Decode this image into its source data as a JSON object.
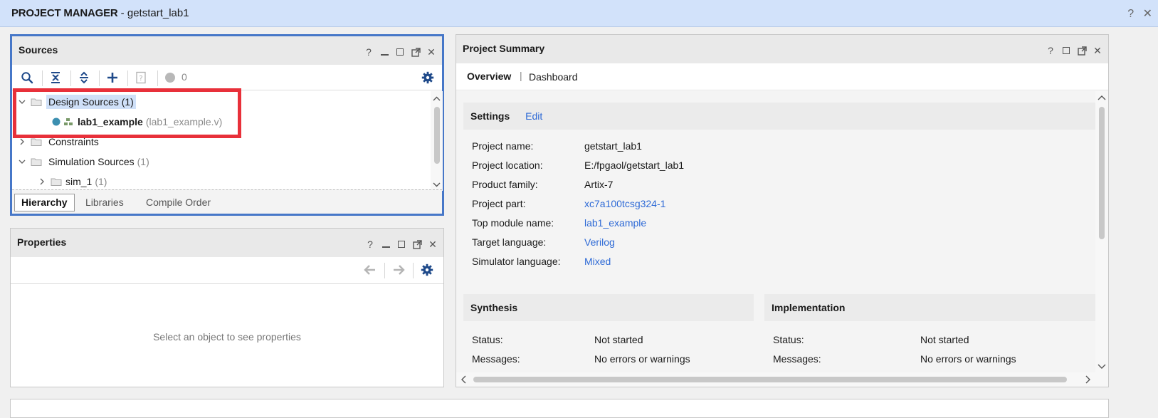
{
  "window": {
    "section_name": "PROJECT MANAGER",
    "separator": " - ",
    "project": "getstart_lab1",
    "help_glyph": "?",
    "close_glyph": "✕"
  },
  "sources": {
    "title": "Sources",
    "badge_count": "0",
    "tree": [
      {
        "label": "Design Sources",
        "count": "(1)"
      },
      {
        "label": "lab1_example",
        "file": "(lab1_example.v)"
      },
      {
        "label": "Constraints"
      },
      {
        "label": "Simulation Sources",
        "count": "(1)"
      },
      {
        "label": "sim_1",
        "count": "(1)"
      }
    ],
    "tabs": [
      "Hierarchy",
      "Libraries",
      "Compile Order"
    ],
    "active_tab": "Hierarchy"
  },
  "properties": {
    "title": "Properties",
    "empty_message": "Select an object to see properties"
  },
  "summary": {
    "title": "Project Summary",
    "tabs": [
      "Overview",
      "Dashboard"
    ],
    "tab_separator": "|",
    "settings": {
      "title": "Settings",
      "edit_link": "Edit",
      "rows": [
        {
          "label": "Project name:",
          "value": "getstart_lab1",
          "link": false
        },
        {
          "label": "Project location:",
          "value": "E:/fpgaol/getstart_lab1",
          "link": false
        },
        {
          "label": "Product family:",
          "value": "Artix-7",
          "link": false
        },
        {
          "label": "Project part:",
          "value": "xc7a100tcsg324-1",
          "link": true
        },
        {
          "label": "Top module name:",
          "value": "lab1_example",
          "link": true
        },
        {
          "label": "Target language:",
          "value": "Verilog",
          "link": true
        },
        {
          "label": "Simulator language:",
          "value": "Mixed",
          "link": true
        }
      ]
    },
    "synthesis": {
      "title": "Synthesis",
      "rows": [
        {
          "label": "Status:",
          "value": "Not started"
        },
        {
          "label": "Messages:",
          "value": "No errors or warnings"
        }
      ]
    },
    "implementation": {
      "title": "Implementation",
      "rows": [
        {
          "label": "Status:",
          "value": "Not started"
        },
        {
          "label": "Messages:",
          "value": "No errors or warnings"
        }
      ]
    }
  },
  "colors": {
    "title_bar": "#d2e2fa",
    "selection_outline": "#4677c8",
    "highlight_box": "#e8303a",
    "link": "#2e6ad6",
    "selected_row": "#cfe0f8"
  }
}
